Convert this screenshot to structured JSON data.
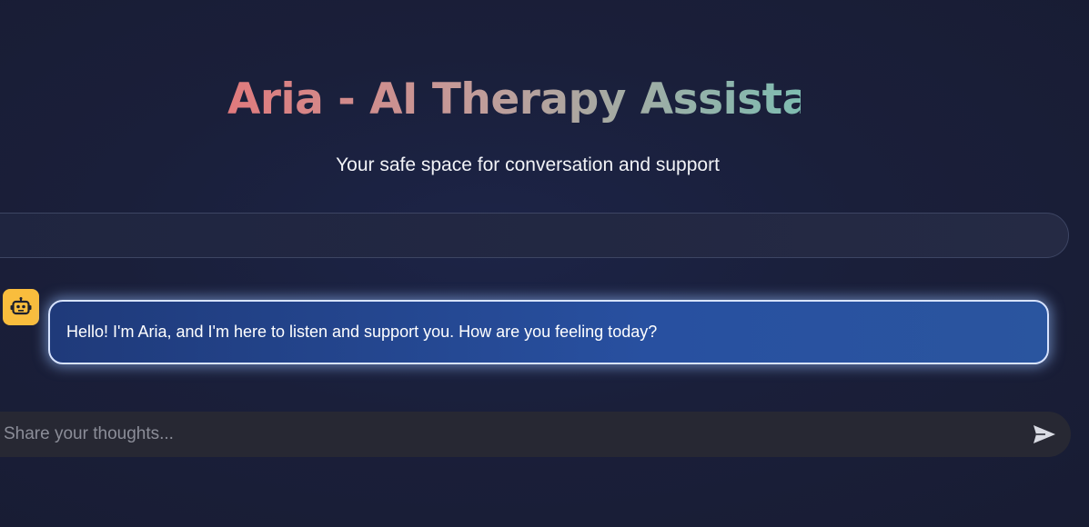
{
  "header": {
    "title": "Aria - AI Therapy Assistant",
    "subtitle": "Your safe space for conversation and support"
  },
  "chat": {
    "messages": [
      {
        "role": "assistant",
        "avatar_icon": "robot-icon",
        "text": "Hello! I'm Aria, and I'm here to listen and support you. How are you feeling today?"
      }
    ]
  },
  "composer": {
    "placeholder": "Share your thoughts...",
    "value": "",
    "send_icon": "send-icon"
  },
  "colors": {
    "background": "#1a1f3a",
    "avatar": "#f9bd3d",
    "bubble": "#2850a0",
    "input_bg": "#272833",
    "title_gradient_start": "#e07a7d",
    "title_gradient_end": "#7fbcb1"
  }
}
